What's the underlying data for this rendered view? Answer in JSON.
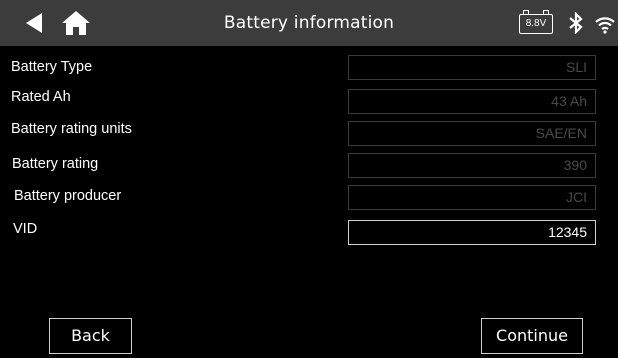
{
  "header": {
    "title": "Battery information",
    "battery_voltage": "8.8V",
    "icons": {
      "back": "back-arrow-icon",
      "home": "home-icon",
      "battery": "battery-icon",
      "bluetooth": "bluetooth-icon",
      "wifi": "wifi-icon"
    }
  },
  "fields": [
    {
      "label": "Battery Type",
      "value": "SLI",
      "editable": false
    },
    {
      "label": "Rated Ah",
      "value": "43 Ah",
      "editable": false
    },
    {
      "label": "Battery rating units",
      "value": "SAE/EN",
      "editable": false
    },
    {
      "label": "Battery rating",
      "value": "390",
      "editable": false
    },
    {
      "label": "Battery producer",
      "value": "JCI",
      "editable": false
    },
    {
      "label": "VID",
      "value": "12345",
      "editable": true
    }
  ],
  "buttons": {
    "back_label": "Back",
    "continue_label": "Continue"
  },
  "colors": {
    "header_bg": "#3c3c3c",
    "background": "#000000",
    "text": "#ffffff",
    "disabled_text": "#4a4a4a",
    "disabled_border": "#3a3a3a",
    "active_border": "#d0d0d0"
  }
}
